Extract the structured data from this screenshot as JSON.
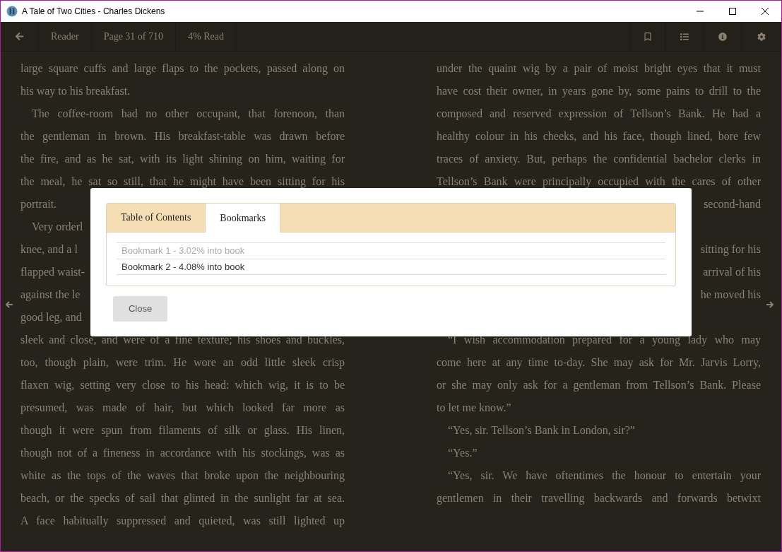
{
  "window": {
    "title": "A Tale of Two Cities - Charles Dickens"
  },
  "toolbar": {
    "labels": [
      "Reader",
      "Page 31 of 710",
      "4% Read"
    ]
  },
  "page": {
    "left_column": [
      {
        "kind": "cont",
        "text": "large square cuffs and large flaps to the pockets, passed along on"
      },
      {
        "kind": "last",
        "text": "his way to his breakfast."
      },
      {
        "kind": "first",
        "text": "The coffee-room had no other occupant, that forenoon, than"
      },
      {
        "kind": "cont",
        "text": "the gentleman in brown. His breakfast-table was drawn before"
      },
      {
        "kind": "cont",
        "text": "the fire, and as he sat, with its light shining on him, waiting for"
      },
      {
        "kind": "cont",
        "text": "the meal, he sat so still, that he might have been sitting for his"
      },
      {
        "kind": "last",
        "text": "portrait."
      },
      {
        "kind": "first_fragment",
        "text": "Very orderl"
      },
      {
        "kind": "fragment",
        "text": "knee, and a l"
      },
      {
        "kind": "fragment",
        "text": "flapped waist-"
      },
      {
        "kind": "fragment",
        "text": "against the le"
      },
      {
        "kind": "fragment",
        "text": "good leg, and"
      },
      {
        "kind": "cont",
        "text": "sleek and close, and were of a fine texture; his shoes and buckles,"
      },
      {
        "kind": "cont",
        "text": "too, though plain, were trim. He wore an odd little sleek crisp"
      },
      {
        "kind": "cont",
        "text": "flaxen wig, setting very close to his head: which wig, it is to be"
      },
      {
        "kind": "cont",
        "text": "presumed, was made of hair, but which looked far more as"
      },
      {
        "kind": "cont",
        "text": "though it were spun from filaments of silk or glass. His linen,"
      },
      {
        "kind": "cont",
        "text": "though not of a fineness in accordance with his stockings, was as"
      },
      {
        "kind": "cont",
        "text": "white as the tops of the waves that broke upon the neighbouring"
      },
      {
        "kind": "cont",
        "text": "beach, or the specks of sail that glinted in the sunlight far at sea."
      },
      {
        "kind": "cont",
        "text": "A face habitually suppressed and quieted, was still lighted up"
      }
    ],
    "right_column": [
      {
        "kind": "cont",
        "text": "under the quaint wig by a pair of moist bright eyes that it must"
      },
      {
        "kind": "cont",
        "text": "have cost their owner, in years gone by, some pains to drill to the"
      },
      {
        "kind": "cont",
        "text": "composed and reserved expression of Tellson’s Bank. He had a"
      },
      {
        "kind": "cont",
        "text": "healthy colour in his cheeks, and his face, though lined, bore few"
      },
      {
        "kind": "cont",
        "text": "traces of anxiety. But, perhaps the confidential bachelor clerks in"
      },
      {
        "kind": "cont",
        "text": "Tellson’s Bank were principally occupied with the cares of other"
      },
      {
        "kind": "right_fragment",
        "text": "second-hand"
      },
      {
        "kind": "blank"
      },
      {
        "kind": "right_fragment",
        "text": "sitting for his"
      },
      {
        "kind": "right_fragment",
        "text": "arrival of his"
      },
      {
        "kind": "right_fragment",
        "text": "he moved his"
      },
      {
        "kind": "blank"
      },
      {
        "kind": "first",
        "text": "“I wish accommodation prepared for a young lady who may"
      },
      {
        "kind": "cont",
        "text": "come here at any time to-day. She may ask for Mr. Jarvis Lorry,"
      },
      {
        "kind": "cont",
        "text": "or she may only ask for a gentleman from Tellson’s Bank. Please"
      },
      {
        "kind": "last",
        "text": "to let me know.”"
      },
      {
        "kind": "first_last",
        "text": "“Yes, sir. Tellson’s Bank in London, sir?”"
      },
      {
        "kind": "first_last",
        "text": "“Yes.”"
      },
      {
        "kind": "first",
        "text": "“Yes, sir. We have oftentimes the honour to entertain your"
      },
      {
        "kind": "cont",
        "text": "gentlemen in their travelling backwards and forwards betwixt"
      }
    ]
  },
  "dialog": {
    "tabs": [
      {
        "label": "Table of Contents",
        "selected": false
      },
      {
        "label": "Bookmarks",
        "selected": true
      }
    ],
    "bookmarks": [
      {
        "label": "Bookmark 1 - 3.02% into book",
        "disabled": true
      },
      {
        "label": "Bookmark 2 - 4.08% into book",
        "disabled": false
      }
    ],
    "close_button": "Close"
  }
}
